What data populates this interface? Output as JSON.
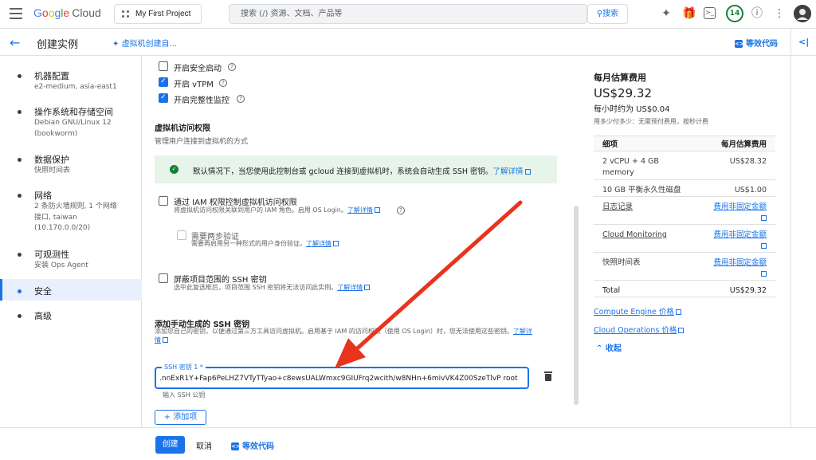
{
  "topbar": {
    "logo_google": [
      "G",
      "o",
      "o",
      "g",
      "l",
      "e"
    ],
    "logo_cloud": "Cloud",
    "project": "My First Project",
    "search_placeholder": "搜索 (/) 资源、文档、产品等",
    "search_button": "搜索",
    "notifications": "14"
  },
  "header": {
    "title": "创建实例",
    "wizard": "虚拟机创建自...",
    "equiv_code": "等效代码"
  },
  "nav": [
    {
      "label": "机器配置",
      "sub": "e2-medium, asia-east1"
    },
    {
      "label": "操作系统和存储空间",
      "sub": "Debian GNU/Linux 12 (bookworm)"
    },
    {
      "label": "数据保护",
      "sub": "快照时间表"
    },
    {
      "label": "网络",
      "sub": "2 条防火墙规则, 1 个网络接口, taiwan (10.170.0.0/20)"
    },
    {
      "label": "可观测性",
      "sub": "安装 Ops Agent"
    },
    {
      "label": "安全",
      "sub": ""
    },
    {
      "label": "高级",
      "sub": ""
    }
  ],
  "main": {
    "secure_boot": "开启安全启动",
    "vtpm": "开启 vTPM",
    "integrity": "开启完整性监控",
    "access_title": "虚拟机访问权限",
    "access_desc": "管理用户连接到虚拟机的方式",
    "info_text": "默认情况下，当您使用此控制台或 gcloud 连接到虚拟机时，系统会自动生成 SSH 密钥。",
    "learn_more": "了解详情",
    "iam_label": "通过 IAM 权限控制虚拟机访问权限",
    "iam_desc": "将虚拟机访问权限关联到用户的 IAM 角色。启用 OS Login。",
    "twofa_label": "需要两步验证",
    "twofa_desc": "需要再启用另一种形式的用户身份验证。",
    "block_label": "屏蔽项目范围的 SSH 密钥",
    "block_desc": "选中此复选框后，项目范围 SSH 密钥将无法访问此实例。",
    "manual_title": "添加手动生成的 SSH 密钥",
    "manual_desc": "添加您自己的密钥，以便通过第三方工具访问虚拟机。启用基于 IAM 的访问权限（使用 OS Login）时，您无法使用这些密钥。",
    "learn_more_wrap": [
      "了解详",
      "情"
    ],
    "ssh_label": "SSH 密钥 1 *",
    "ssh_value": ".nnExR1Y+Fap6PeLHZ7VTyTTyao+c8ewsUALWmxc9GIUFrq2wcith/w8NHn+6mivVK4Z00SzeTlvP root",
    "ssh_hint": "输入 SSH 公钥",
    "add_item": "添加项"
  },
  "cost": {
    "title": "每月估算费用",
    "total_big": "US$29.32",
    "hourly": "每小时约为 US$0.04",
    "note": "用多少付多少：无需预付费用，按秒计费",
    "col_item": "细项",
    "col_cost": "每月估算费用",
    "rows": [
      {
        "item": "2 vCPU + 4 GB memory",
        "item1": "2 vCPU + 4 GB",
        "item2": "memory",
        "cost": "US$28.32"
      },
      {
        "item": "10 GB 平衡永久性磁盘",
        "cost": "US$1.00"
      },
      {
        "item": "日志记录",
        "cost": "费用非固定金额"
      },
      {
        "item": "Cloud Monitoring",
        "cost": "费用非固定金额"
      },
      {
        "item": "快照时间表",
        "cost": "费用非固定金额"
      }
    ],
    "total_label": "Total",
    "total_value": "US$29.32",
    "link1": "Compute Engine 价格",
    "link2": "Cloud Operations 价格",
    "collapse": "收起"
  },
  "bottom": {
    "create": "创建",
    "cancel": "取消",
    "equiv_code": "等效代码"
  },
  "colors": {
    "accent": "#1a73e8",
    "annotation_arrow": "#e8341c",
    "success": "#188038"
  }
}
